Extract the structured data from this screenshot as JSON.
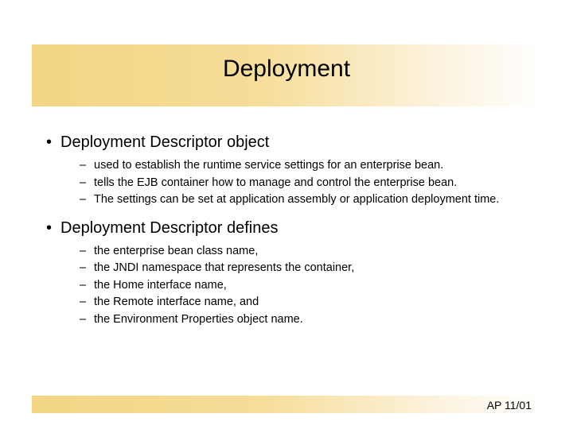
{
  "title": "Deployment",
  "bullets": [
    {
      "text": "Deployment Descriptor object",
      "sub": [
        "used to establish the runtime service settings for an enterprise bean.",
        "tells the EJB container how to manage and control the enterprise bean.",
        "The settings can be set at application assembly or application deployment time."
      ]
    },
    {
      "text": "Deployment Descriptor defines",
      "sub": [
        "the enterprise bean class name,",
        "the JNDI namespace that represents the container,",
        "the Home interface name,",
        " the Remote interface name, and",
        " the Environment Properties object name."
      ]
    }
  ],
  "footer": "AP 11/01"
}
